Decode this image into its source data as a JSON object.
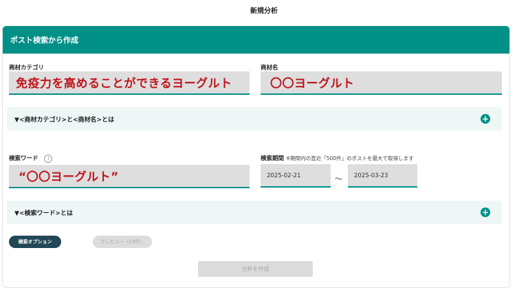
{
  "page": {
    "title": "新規分析"
  },
  "panel": {
    "title": "ポスト検索から作成"
  },
  "category": {
    "label": "商材カテゴリ",
    "value": "免疫力を高めることができるヨーグルト"
  },
  "product": {
    "label": "商材名",
    "value": "〇〇ヨーグルト"
  },
  "accordion1": {
    "label": "▼<商材カテゴリ>と<商材名>とは",
    "icon": "plus-icon"
  },
  "search": {
    "label": "検索ワード",
    "help_icon": "?",
    "value": "“〇〇ヨーグルト”"
  },
  "period": {
    "label": "検索期間",
    "note": "※期間内の直近「500件」のポストを最大で取得します",
    "start": "2025-02-21",
    "separator": "〜",
    "end": "2025-03-23"
  },
  "accordion2": {
    "label": "▼<検索ワード>とは",
    "icon": "plus-icon"
  },
  "buttons": {
    "options": "検索オプション",
    "preview": "プレビュー（10件）",
    "create": "分析を作成"
  },
  "colors": {
    "teal": "#009088",
    "dark_button": "#224756",
    "highlight_text": "#c0151c"
  }
}
